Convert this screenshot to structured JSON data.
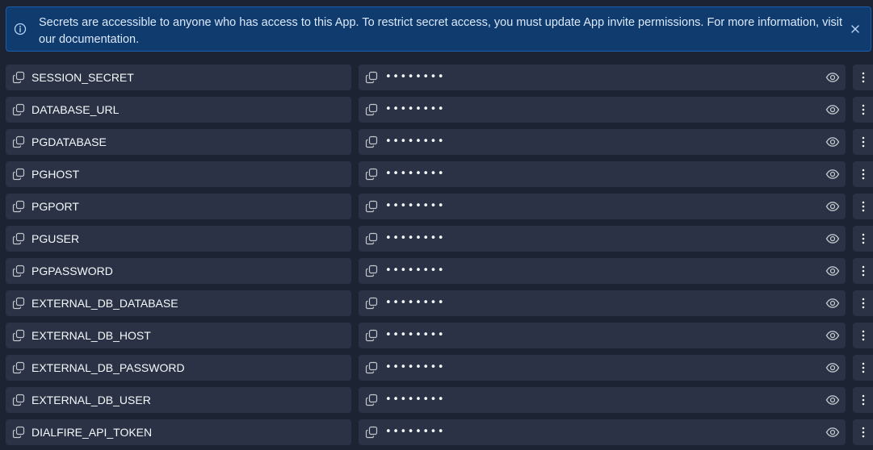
{
  "banner": {
    "text": "Secrets are accessible to anyone who has access to this App. To restrict secret access, you must update App invite permissions. For more information, visit",
    "link": "our documentation."
  },
  "mask": "••••••••",
  "secrets": [
    {
      "key": "SESSION_SECRET"
    },
    {
      "key": "DATABASE_URL"
    },
    {
      "key": "PGDATABASE"
    },
    {
      "key": "PGHOST"
    },
    {
      "key": "PGPORT"
    },
    {
      "key": "PGUSER"
    },
    {
      "key": "PGPASSWORD"
    },
    {
      "key": "EXTERNAL_DB_DATABASE"
    },
    {
      "key": "EXTERNAL_DB_HOST"
    },
    {
      "key": "EXTERNAL_DB_PASSWORD"
    },
    {
      "key": "EXTERNAL_DB_USER"
    },
    {
      "key": "DIALFIRE_API_TOKEN"
    }
  ],
  "icons": {
    "info": "info-icon",
    "close": "close-icon",
    "copy": "copy-icon",
    "eye": "eye-icon",
    "menu": "vertical-dots-icon"
  },
  "colors": {
    "background": "#1c2333",
    "row": "#2b3245",
    "banner_bg": "#0f3b6e",
    "banner_border": "#1a5dab",
    "text": "#f5f9fc"
  }
}
